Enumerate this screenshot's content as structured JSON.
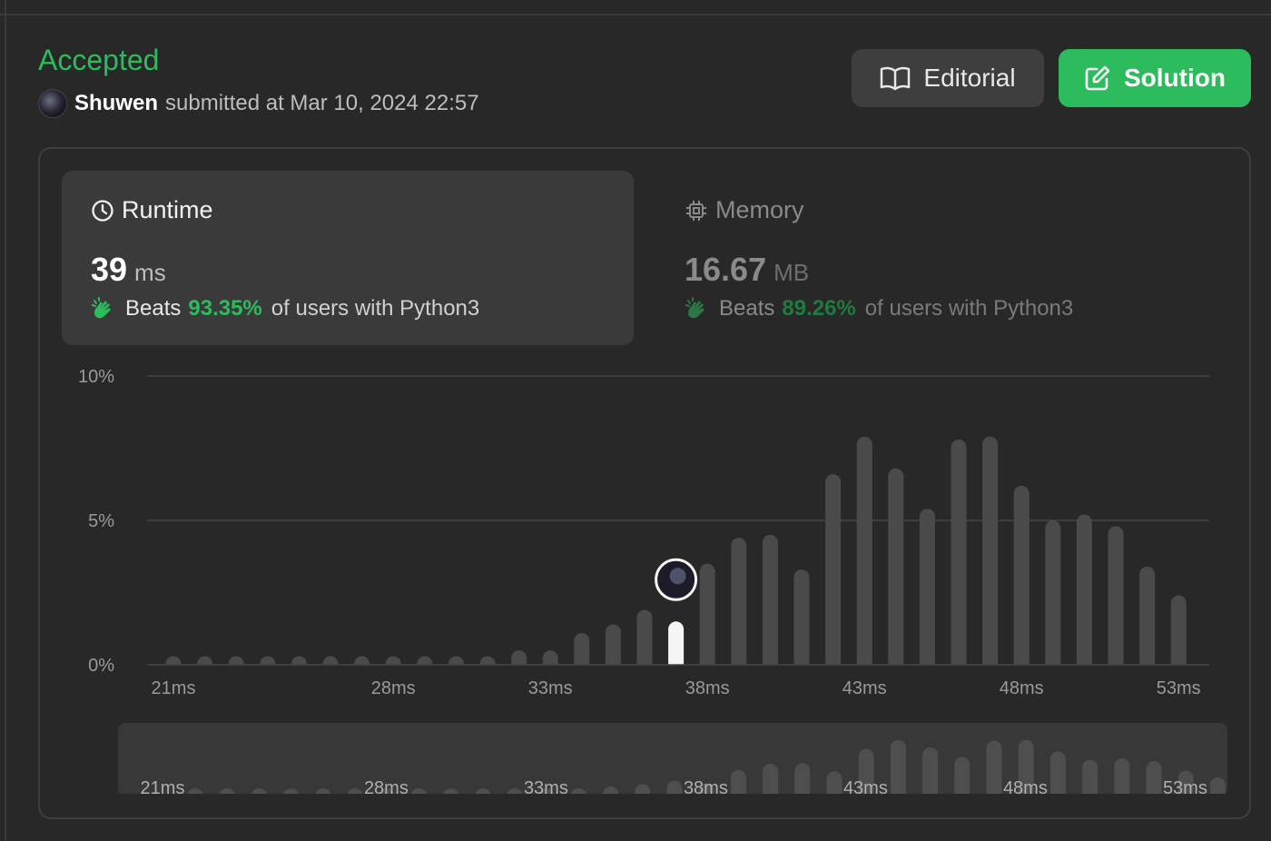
{
  "status": "Accepted",
  "submission": {
    "user": "Shuwen",
    "text": "submitted at Mar 10, 2024 22:57"
  },
  "buttons": {
    "editorial": "Editorial",
    "solution": "Solution"
  },
  "runtime": {
    "title": "Runtime",
    "value": "39",
    "unit": "ms",
    "beats_label": "Beats",
    "beats_pct": "93.35%",
    "beats_rest": "of users with Python3"
  },
  "memory": {
    "title": "Memory",
    "value": "16.67",
    "unit": "MB",
    "beats_label": "Beats",
    "beats_pct": "89.26%",
    "beats_rest": "of users with Python3"
  },
  "colors": {
    "accent": "#2cbb5d",
    "bar": "#4a4a4a",
    "bar_highlight": "#f5f5f5"
  },
  "chart_data": {
    "type": "bar",
    "ylabel_ticks": [
      "0%",
      "5%",
      "10%"
    ],
    "ylim": [
      0,
      10
    ],
    "x_tick_labels": [
      "21ms",
      "28ms",
      "33ms",
      "38ms",
      "43ms",
      "48ms",
      "53ms"
    ],
    "categories": [
      "21ms",
      "22ms",
      "23ms",
      "24ms",
      "25ms",
      "26ms",
      "27ms",
      "28ms",
      "29ms",
      "30ms",
      "31ms",
      "32ms",
      "33ms",
      "34ms",
      "35ms",
      "36ms",
      "37ms",
      "38ms",
      "39ms",
      "40ms",
      "41ms",
      "42ms",
      "43ms",
      "44ms",
      "45ms",
      "46ms",
      "47ms",
      "48ms",
      "49ms",
      "50ms",
      "51ms",
      "52ms",
      "53ms",
      "54ms"
    ],
    "values": [
      0.3,
      0.3,
      0.3,
      0.3,
      0.3,
      0.3,
      0.3,
      0.3,
      0.3,
      0.3,
      0.3,
      0.5,
      0.5,
      1.1,
      1.4,
      1.9,
      1.5,
      3.5,
      4.4,
      4.5,
      3.3,
      6.6,
      7.9,
      6.8,
      5.4,
      7.8,
      7.9,
      6.2,
      5.0,
      5.2,
      4.8,
      3.4,
      2.4,
      0.0
    ],
    "highlight_index": 16,
    "grid": true
  }
}
